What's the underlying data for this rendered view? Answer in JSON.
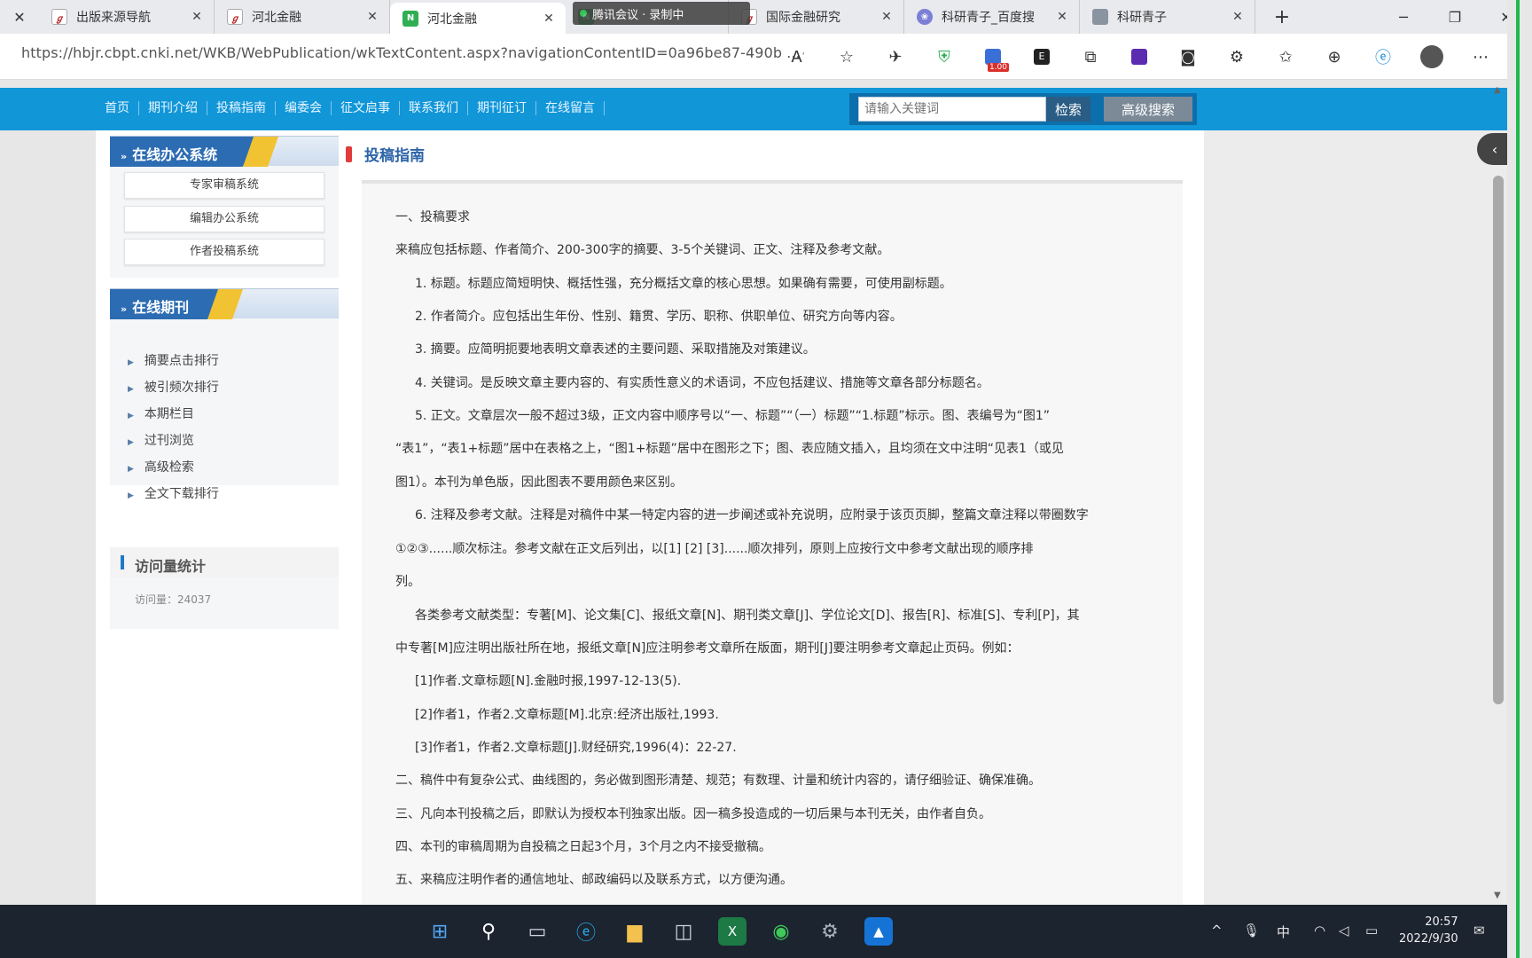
{
  "browser": {
    "tabs": [
      {
        "label": "出版来源导航",
        "icon": "cnki-icon"
      },
      {
        "label": "河北金融",
        "icon": "cnki-icon"
      },
      {
        "label": "河北金融",
        "icon": "green-page-icon"
      },
      {
        "label": "国际金融研究",
        "icon": "cnki-icon"
      },
      {
        "label": "科研青子_百度搜",
        "icon": "purple-paw-icon"
      },
      {
        "label": "科研青子",
        "icon": "gray-page-icon"
      }
    ],
    "overlay_text": "腾讯会议 · 录制中",
    "url": "https://hbjr.cbpt.cnki.net/WKB/WebPublication/wkTextContent.aspx?navigationContentID=0a96be87-490b ...",
    "ext_badge": "1.00"
  },
  "site": {
    "nav": [
      "首页",
      "期刊介绍",
      "投稿指南",
      "编委会",
      "征文启事",
      "联系我们",
      "期刊征订",
      "在线留言"
    ],
    "search_placeholder": "请输入关键词",
    "search_button": "检索",
    "advanced_button": "高级搜索"
  },
  "sidebar": {
    "office_title": "在线办公系统",
    "office_buttons": [
      "专家审稿系统",
      "编辑办公系统",
      "作者投稿系统"
    ],
    "journal_title": "在线期刊",
    "journal_items": [
      "摘要点击排行",
      "被引频次排行",
      "本期栏目",
      "过刊浏览",
      "高级检索",
      "全文下载排行"
    ],
    "stats_title": "访问量统计",
    "stats_value": "访问量：24037"
  },
  "content": {
    "title": "投稿指南",
    "paragraphs": [
      "一、投稿要求",
      "来稿应包括标题、作者简介、200-300字的摘要、3-5个关键词、正文、注释及参考文献。",
      "1. 标题。标题应简短明快、概括性强，充分概括文章的核心思想。如果确有需要，可使用副标题。",
      "2. 作者简介。应包括出生年份、性别、籍贯、学历、职称、供职单位、研究方向等内容。",
      "3. 摘要。应简明扼要地表明文章表述的主要问题、采取措施及对策建议。",
      "4. 关键词。是反映文章主要内容的、有实质性意义的术语词，不应包括建议、措施等文章各部分标题名。",
      "5. 正文。文章层次一般不超过3级，正文内容中顺序号以“一、标题”“（一）标题”“1.标题”标示。图、表编号为“图1”",
      "“表1”，“表1+标题”居中在表格之上，“图1+标题”居中在图形之下；图、表应随文插入，且均须在文中注明“见表1（或见",
      "图1）。本刊为单色版，因此图表不要用颜色来区别。",
      "6. 注释及参考文献。注释是对稿件中某一特定内容的进一步阐述或补充说明，应附录于该页页脚，整篇文章注释以带圈数字",
      "①②③......顺次标注。参考文献在正文后列出，以[1] [2] [3]......顺次排列，原则上应按行文中参考文献出现的顺序排",
      "列。",
      "各类参考文献类型：专著[M]、论文集[C]、报纸文章[N]、期刊类文章[J]、学位论文[D]、报告[R]、标准[S]、专利[P]，其",
      "中专著[M]应注明出版社所在地，报纸文章[N]应注明参考文章所在版面，期刊[J]要注明参考文章起止页码。例如：",
      "[1]作者.文章标题[N].金融时报,1997-12-13(5).",
      "[2]作者1，作者2.文章标题[M].北京:经济出版社,1993.",
      "[3]作者1，作者2.文章标题[J].财经研究,1996(4)：22-27.",
      "二、稿件中有复杂公式、曲线图的，务必做到图形清楚、规范；有数理、计量和统计内容的，请仔细验证、确保准确。",
      "三、凡向本刊投稿之后，即默认为授权本刊独家出版。因一稿多投造成的一切后果与本刊无关，由作者自负。",
      "四、本刊的审稿周期为自投稿之日起3个月，3个月之内不接受撤稿。",
      "五、来稿应注明作者的通信地址、邮政编码以及联系方式，以方便沟通。"
    ]
  },
  "taskbar": {
    "ime": "中",
    "time": "20:57",
    "date": "2022/9/30"
  },
  "colors": {
    "site_bar": "#1196d8",
    "panel_blue": "#2c6cb3",
    "accent_yellow": "#f1c232",
    "title_blue": "#2d64a8",
    "red_marker": "#e23b3b"
  }
}
